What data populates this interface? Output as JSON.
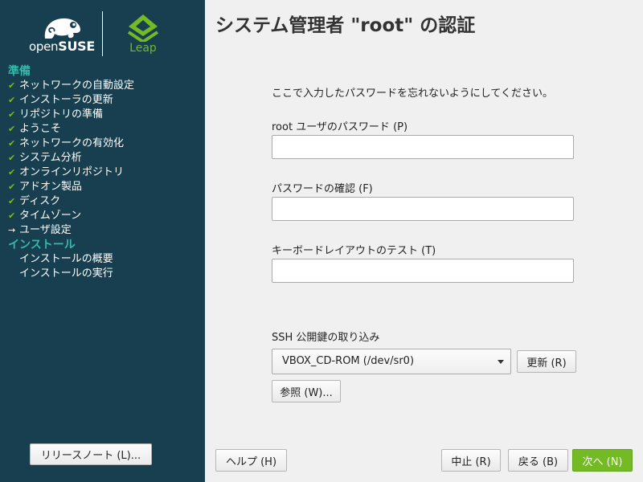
{
  "branding": {
    "opensuse_prefix": "open",
    "opensuse_brand": "SUSE",
    "leap": "Leap",
    "leap_color": "#73ba25"
  },
  "sidebar": {
    "sections": [
      {
        "label": "準備",
        "steps": [
          {
            "label": "ネットワークの自動設定",
            "state": "done"
          },
          {
            "label": "インストーラの更新",
            "state": "done"
          },
          {
            "label": "リポジトリの準備",
            "state": "done"
          },
          {
            "label": "ようこそ",
            "state": "done"
          },
          {
            "label": "ネットワークの有効化",
            "state": "done"
          },
          {
            "label": "システム分析",
            "state": "done"
          },
          {
            "label": "オンラインリポジトリ",
            "state": "done"
          },
          {
            "label": "アドオン製品",
            "state": "done"
          },
          {
            "label": "ディスク",
            "state": "done"
          },
          {
            "label": "タイムゾーン",
            "state": "done"
          },
          {
            "label": "ユーザ設定",
            "state": "current"
          }
        ]
      },
      {
        "label": "インストール",
        "steps": [
          {
            "label": "インストールの概要",
            "state": "pending"
          },
          {
            "label": "インストールの実行",
            "state": "pending"
          }
        ]
      }
    ],
    "release_notes_button": "リリースノート (L)..."
  },
  "main": {
    "title": "システム管理者 \"root\" の認証",
    "instruction": "ここで入力したパスワードを忘れないようにしてください。",
    "password_label": "root ユーザのパスワード (P)",
    "password_value": "",
    "confirm_label": "パスワードの確認 (F)",
    "confirm_value": "",
    "keyboard_test_label": "キーボードレイアウトのテスト (T)",
    "keyboard_test_value": "",
    "ssh_label": "SSH 公開鍵の取り込み",
    "ssh_source": "VBOX_CD-ROM (/dev/sr0)",
    "refresh_button": "更新 (R)",
    "browse_button": "参照 (W)..."
  },
  "footer": {
    "help_button": "ヘルプ (H)",
    "abort_button": "中止 (R)",
    "back_button": "戻る (B)",
    "next_button": "次へ (N)"
  },
  "colors": {
    "sidebar_bg": "#173f4f",
    "section_heading": "#35b9ab",
    "check": "#73ba25",
    "primary_button": "#73ba25"
  }
}
